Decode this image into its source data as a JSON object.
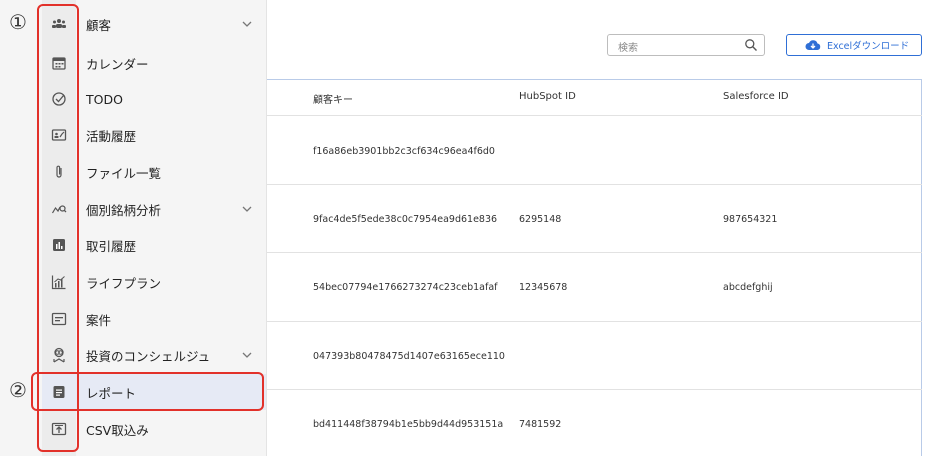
{
  "sidebar": {
    "items": [
      {
        "label": "顧客",
        "icon": "customers-icon",
        "has_chevron": true
      },
      {
        "label": "カレンダー",
        "icon": "calendar-icon",
        "has_chevron": false
      },
      {
        "label": "TODO",
        "icon": "check-circle-icon",
        "has_chevron": false
      },
      {
        "label": "活動履歴",
        "icon": "activity-card-icon",
        "has_chevron": false
      },
      {
        "label": "ファイル一覧",
        "icon": "paperclip-icon",
        "has_chevron": false
      },
      {
        "label": "個別銘柄分析",
        "icon": "chart-search-icon",
        "has_chevron": true
      },
      {
        "label": "取引履歴",
        "icon": "bar-chart-icon",
        "has_chevron": false
      },
      {
        "label": "ライフプラン",
        "icon": "growth-chart-icon",
        "has_chevron": false
      },
      {
        "label": "案件",
        "icon": "document-icon",
        "has_chevron": false
      },
      {
        "label": "投資のコンシェルジュ",
        "icon": "concierge-icon",
        "has_chevron": true
      },
      {
        "label": "レポート",
        "icon": "report-icon",
        "has_chevron": false,
        "active": true
      },
      {
        "label": "CSV取込み",
        "icon": "upload-icon",
        "has_chevron": false
      }
    ]
  },
  "callouts": {
    "one": "①",
    "two": "②",
    "color": "#e2312a"
  },
  "toolbar": {
    "search_placeholder": "検索",
    "excel_button": "Excelダウンロード"
  },
  "table": {
    "headers": [
      "顧客キー",
      "HubSpot ID",
      "Salesforce ID"
    ],
    "rows": [
      {
        "key": "f16a86eb3901bb2c3cf634c96ea4f6d0",
        "hubspot": "",
        "salesforce": ""
      },
      {
        "key": "9fac4de5f5ede38c0c7954ea9d61e836",
        "hubspot": "6295148",
        "salesforce": "987654321"
      },
      {
        "key": "54bec07794e1766273274c23ceb1afaf",
        "hubspot": "12345678",
        "salesforce": "abcdefghij"
      },
      {
        "key": "047393b80478475d1407e63165ece110",
        "hubspot": "",
        "salesforce": ""
      },
      {
        "key": "bd411448f38794b1e5bb9d44d953151a",
        "hubspot": "7481592",
        "salesforce": ""
      }
    ]
  },
  "colors": {
    "accent": "#2f6fd6",
    "callout": "#e2312a",
    "active_bg": "#e6eaf5"
  }
}
